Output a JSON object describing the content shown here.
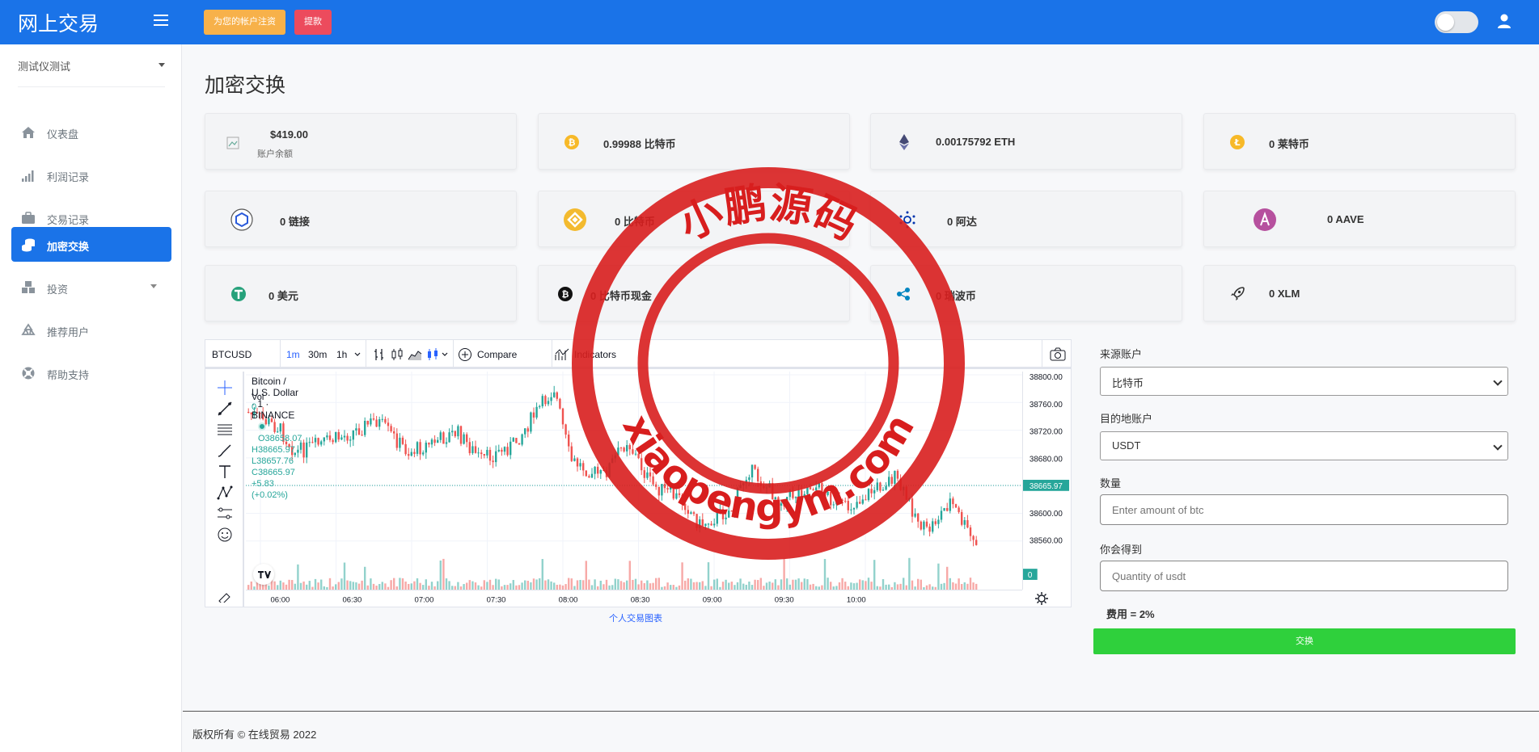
{
  "brand": "网上交易",
  "header": {
    "deposit_label": "为您的帐户注资",
    "withdraw_label": "提款"
  },
  "sidebar": {
    "user_name": "测试仪测试",
    "items": [
      {
        "label": "仪表盘",
        "icon": "home-icon"
      },
      {
        "label": "利润记录",
        "icon": "signal-icon"
      },
      {
        "label": "交易记录",
        "icon": "briefcase-icon"
      },
      {
        "label": "加密交换",
        "icon": "coins-icon",
        "active": true
      },
      {
        "label": "投资",
        "icon": "cubes-icon",
        "has_submenu": true
      },
      {
        "label": "推荐用户",
        "icon": "recycle-icon"
      },
      {
        "label": "帮助支持",
        "icon": "lifebuoy-icon"
      }
    ]
  },
  "page_title": "加密交换",
  "balance": {
    "value": "$419.00",
    "label": "账户余额"
  },
  "assets": [
    {
      "value": "0.99988 比特币",
      "icon": "bitcoin-icon",
      "color": "#f7b928"
    },
    {
      "value": "0.00175792 ETH",
      "icon": "ethereum-icon",
      "color": "#454a75"
    },
    {
      "value": "0 莱特币",
      "icon": "litecoin-icon",
      "color": "#f7b928"
    },
    {
      "value": "0 链接",
      "icon": "chainlink-icon",
      "color": "#2a5ada"
    },
    {
      "value": "0 比特币",
      "icon": "bnb-icon",
      "color": "#f3ba2f"
    },
    {
      "value": "0 阿达",
      "icon": "cardano-icon",
      "color": "#0033ad"
    },
    {
      "value": "0 AAVE",
      "icon": "aave-icon",
      "color": "#b6509e"
    },
    {
      "value": "0 美元",
      "icon": "tether-icon",
      "color": "#26a17b"
    },
    {
      "value": "0 比特币现金",
      "icon": "bitcoin-cash-icon",
      "color": "#111111"
    },
    {
      "value": "0 瑞波币",
      "icon": "ripple-icon",
      "color": "#0085c0"
    },
    {
      "value": "0 XLM",
      "icon": "rocket-icon",
      "color": "#333333"
    }
  ],
  "chart": {
    "symbol": "BTCUSD",
    "intervals": [
      "1m",
      "30m",
      "1h"
    ],
    "active_interval": "1m",
    "compare_label": "Compare",
    "indicators_label": "Indicators",
    "title": "Bitcoin / U.S. Dollar · 1 · BINANCE",
    "ohlc": "O38658.07 H38665.97 L38657.76 C38665.97 +5.83 (+0.02%)",
    "vol_label": "Vol",
    "vol_value": "0",
    "price_ticks": [
      "38800.00",
      "38760.00",
      "38720.00",
      "38680.00",
      "38640.00",
      "38600.00",
      "38560.00"
    ],
    "current_price": "38665.97",
    "time_ticks": [
      "06:00",
      "06:30",
      "07:00",
      "07:30",
      "08:00",
      "08:30",
      "09:00",
      "09:30",
      "10:00"
    ],
    "volume_badge": "0",
    "caption": "个人交易图表"
  },
  "form": {
    "source_label": "来源账户",
    "source_value": "比特币",
    "dest_label": "目的地账户",
    "dest_value": "USDT",
    "amount_label": "数量",
    "amount_placeholder": "Enter amount of btc",
    "receive_label": "你会得到",
    "receive_placeholder": "Quantity of usdt",
    "fee_text": "费用 = 2%",
    "exchange_label": "交换"
  },
  "footer": "版权所有 © 在线贸易 2022",
  "watermark": {
    "top": "小鹏源码",
    "bottom": "xiaopengym.com"
  },
  "colors": {
    "primary": "#1a73e8",
    "up": "#26a69a",
    "down": "#ef5350",
    "exchange": "#2fd03c",
    "stamp": "#d81e1e"
  }
}
